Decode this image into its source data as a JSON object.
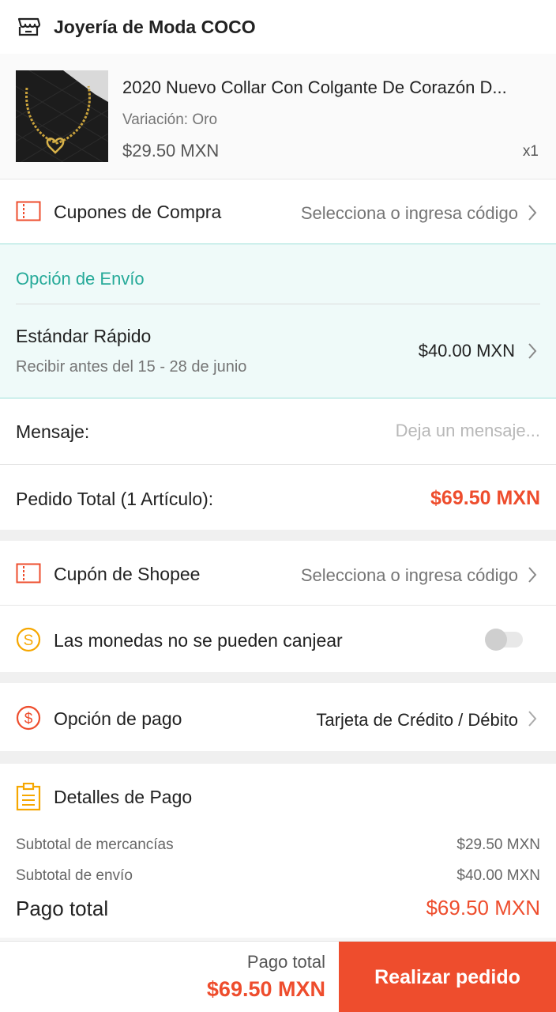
{
  "shop": {
    "name": "Joyería de Moda COCO",
    "icon": "store-icon"
  },
  "product": {
    "title": "2020 Nuevo Collar Con Colgante De Corazón D...",
    "variation": "Variación: Oro",
    "price": "$29.50 MXN",
    "quantity": "x1"
  },
  "shop_voucher": {
    "label": "Cupones de Compra",
    "value": "Selecciona o ingresa código",
    "icon": "coupon-icon"
  },
  "shipping": {
    "section_title": "Opción de Envío",
    "method": "Estándar Rápido",
    "eta": "Recibir antes del 15 - 28 de junio",
    "price": "$40.00 MXN",
    "accent_color": "#26aa99"
  },
  "message": {
    "label": "Mensaje:",
    "placeholder": "Deja un mensaje..."
  },
  "order_total": {
    "label": "Pedido Total (1 Artículo):",
    "value": "$69.50 MXN"
  },
  "shopee_voucher": {
    "label": "Cupón de Shopee",
    "value": "Selecciona o ingresa código",
    "icon": "coupon-icon"
  },
  "coins": {
    "label": "Las monedas no se pueden canjear",
    "icon": "coin-icon",
    "toggle_on": false
  },
  "payment_option": {
    "label": "Opción de pago",
    "value": "Tarjeta de Crédito / Débito",
    "icon": "dollar-circle-icon"
  },
  "payment_details": {
    "title": "Detalles de Pago",
    "icon": "clipboard-icon",
    "rows": [
      {
        "label": "Subtotal de mercancías",
        "value": "$29.50 MXN"
      },
      {
        "label": "Subtotal de envío",
        "value": "$40.00 MXN"
      }
    ],
    "total_label": "Pago total",
    "total_value": "$69.50 MXN"
  },
  "bottom_bar": {
    "total_label": "Pago total",
    "total_value": "$69.50 MXN",
    "button_label": "Realizar pedido",
    "brand_color": "#ee4d2d"
  }
}
